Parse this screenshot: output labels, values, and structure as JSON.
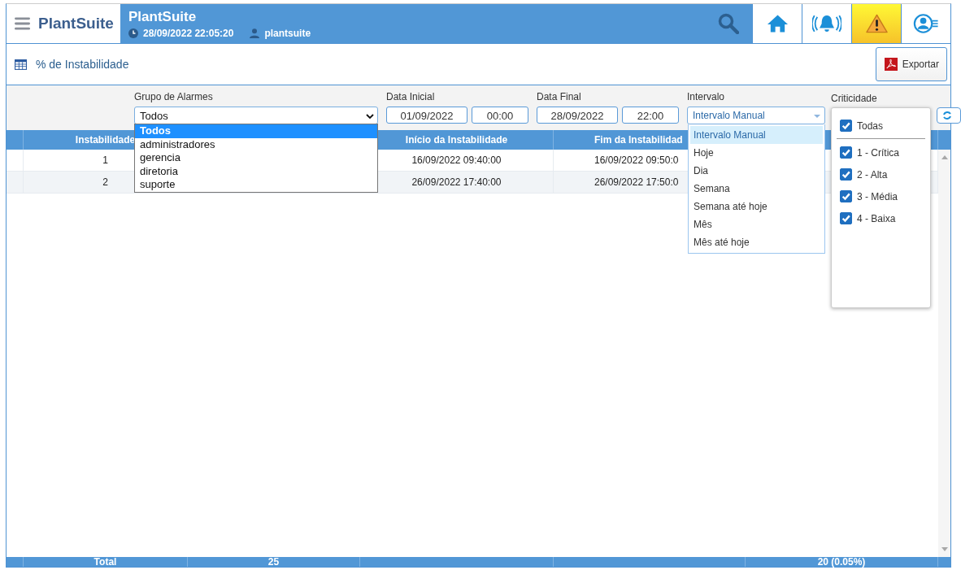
{
  "header": {
    "logo": "PlantSuite",
    "title": "PlantSuite",
    "datetime": "28/09/2022 22:05:20",
    "user": "plantsuite",
    "nav": [
      {
        "kind": "home",
        "selected": false
      },
      {
        "kind": "alarm",
        "selected": false
      },
      {
        "kind": "warning",
        "selected": true
      },
      {
        "kind": "profile",
        "selected": false
      }
    ]
  },
  "page": {
    "title": "% de Instabilidade",
    "export_button": "Exportar"
  },
  "filters": {
    "group": {
      "label": "Grupo de Alarmes",
      "value": "Todos",
      "options": [
        {
          "label": "Todos",
          "selected": true
        },
        {
          "label": "administradores",
          "selected": false
        },
        {
          "label": "gerencia",
          "selected": false
        },
        {
          "label": "diretoria",
          "selected": false
        },
        {
          "label": "suporte",
          "selected": false
        }
      ]
    },
    "start": {
      "label": "Data Inicial",
      "date": "01/09/2022",
      "time": "00:00"
    },
    "end": {
      "label": "Data Final",
      "date": "28/09/2022",
      "time": "22:00"
    },
    "interval": {
      "label": "Intervalo",
      "value": "Intervalo Manual",
      "options": [
        {
          "label": "Intervalo Manual",
          "selected": true
        },
        {
          "label": "Hoje",
          "selected": false
        },
        {
          "label": "Dia",
          "selected": false
        },
        {
          "label": "Semana",
          "selected": false
        },
        {
          "label": "Semana até hoje",
          "selected": false
        },
        {
          "label": "Mês",
          "selected": false
        },
        {
          "label": "Mês até hoje",
          "selected": false
        }
      ]
    },
    "criticality": {
      "label": "Criticidade",
      "all": {
        "label": "Todas",
        "checked": true
      },
      "options": [
        {
          "label": "1 - Crítica",
          "checked": true
        },
        {
          "label": "2 - Alta",
          "checked": true
        },
        {
          "label": "3 - Média",
          "checked": true
        },
        {
          "label": "4 - Baixa",
          "checked": true
        }
      ]
    }
  },
  "table": {
    "columns": {
      "instability": "Instabilidade",
      "start": "Início da Instabilidade",
      "end": "Fim da Instabilidad"
    },
    "rows": [
      {
        "instability": "1",
        "start": "16/09/2022 09:40:00",
        "end": "16/09/2022 09:50:0"
      },
      {
        "instability": "2",
        "start": "26/09/2022 17:40:00",
        "end": "26/09/2022 17:50:0"
      }
    ],
    "footer": {
      "label": "Total",
      "column_3": "25",
      "column_6": "20 (0.05%)"
    }
  }
}
